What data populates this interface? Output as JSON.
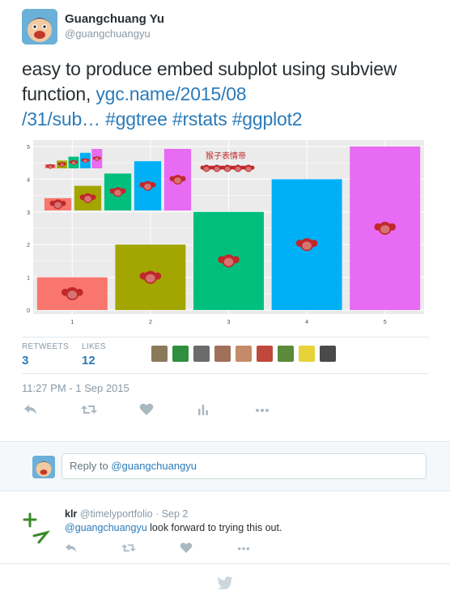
{
  "tweet": {
    "author_name": "Guangchuang Yu",
    "author_handle": "@guangchuangyu",
    "text_plain": "easy to produce embed subplot using subview function, ",
    "link_text": "ygc.name/2015/08/31/sub…",
    "link_line1": "ygc.name/2015/08",
    "link_line2": "/31/sub…",
    "hashtags": [
      "#ggtree",
      "#rstats",
      "#ggplot2"
    ],
    "retweets_label": "RETWEETS",
    "retweets_count": "3",
    "likes_label": "LIKES",
    "likes_count": "12",
    "timestamp": "11:27 PM - 1 Sep 2015",
    "actions": [
      "reply-icon",
      "retweet-icon",
      "like-icon",
      "analytics-icon",
      "more-icon"
    ]
  },
  "chart_data": {
    "type": "bar",
    "title_cn": "猴子表情帝",
    "categories": [
      "1",
      "2",
      "3",
      "4",
      "5"
    ],
    "values": [
      1,
      2,
      3,
      4,
      5
    ],
    "colors": [
      "#f8766d",
      "#a3a500",
      "#00bf7d",
      "#00b0f6",
      "#e76bf3"
    ],
    "yticks": [
      "0",
      "1",
      "2",
      "3",
      "4",
      "5"
    ],
    "ylim": [
      0,
      5
    ],
    "grid": true,
    "icon": "monkey-icon",
    "embedded_subplots": [
      {
        "type": "bar",
        "categories": [
          "1",
          "2",
          "3",
          "4",
          "5"
        ],
        "values": [
          1,
          2,
          3,
          4,
          5
        ],
        "colors": [
          "#f8766d",
          "#a3a500",
          "#00bf7d",
          "#00b0f6",
          "#e76bf3"
        ]
      },
      {
        "type": "bar",
        "categories": [
          "1",
          "2",
          "3",
          "4",
          "5"
        ],
        "values": [
          1,
          2,
          3,
          4,
          5
        ],
        "colors": [
          "#f8766d",
          "#a3a500",
          "#00bf7d",
          "#00b0f6",
          "#e76bf3"
        ]
      }
    ]
  },
  "likers": [
    "#8a7a5a",
    "#2f8f3f",
    "#6b6b6b",
    "#a0705a",
    "#c58a6a",
    "#c0483a",
    "#5a8a3a",
    "#e8d23a",
    "#4a4a4a"
  ],
  "reply_box": {
    "prefix": "Reply to ",
    "mention": "@guangchuangyu"
  },
  "reply": {
    "name": "klr",
    "handle": "@timelyportfolio",
    "date": "· Sep 2",
    "mention": "@guangchuangyu",
    "text": " look forward to trying this out."
  },
  "colors": {
    "link": "#2b7bb9",
    "muted": "#8899a6",
    "text": "#292f33"
  }
}
